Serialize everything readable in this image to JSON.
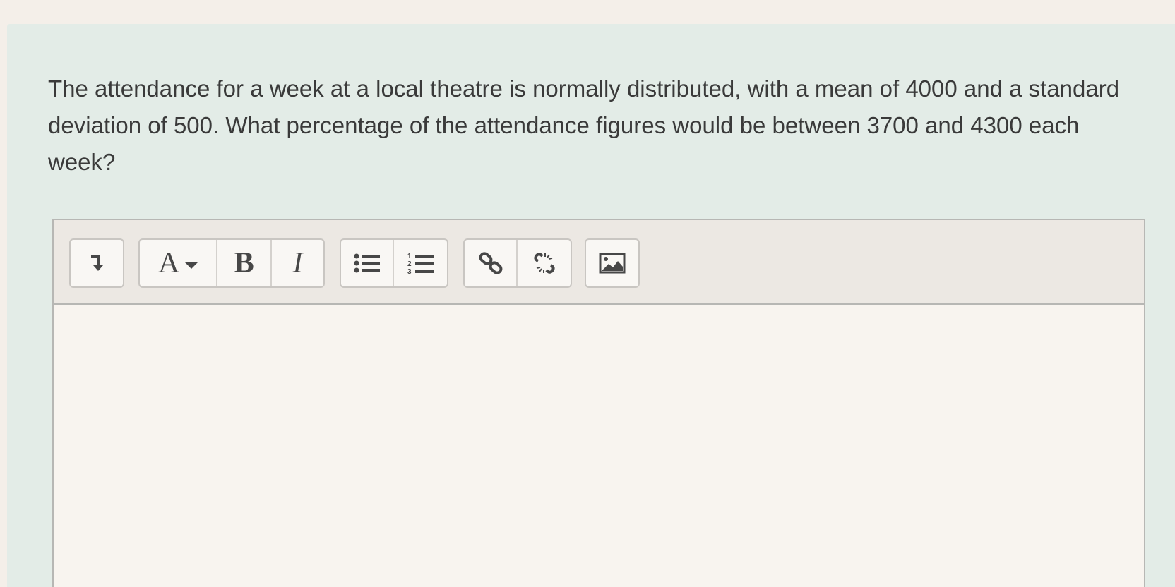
{
  "question": {
    "text": "The attendance for a week at a local theatre is normally distributed, with a mean of 4000 and a standard deviation of 500. What percentage of the attendance figures would be between 3700 and 4300 each week?"
  },
  "toolbar": {
    "groups": [
      {
        "name": "toggle",
        "buttons": [
          {
            "icon": "expand-toolbar-icon"
          }
        ]
      },
      {
        "name": "text-format",
        "buttons": [
          {
            "icon": "font-style-icon",
            "label": "A"
          },
          {
            "icon": "bold-icon",
            "label": "B"
          },
          {
            "icon": "italic-icon",
            "label": "I"
          }
        ]
      },
      {
        "name": "lists",
        "buttons": [
          {
            "icon": "unordered-list-icon"
          },
          {
            "icon": "ordered-list-icon"
          }
        ]
      },
      {
        "name": "links",
        "buttons": [
          {
            "icon": "link-icon"
          },
          {
            "icon": "unlink-icon"
          }
        ]
      },
      {
        "name": "media",
        "buttons": [
          {
            "icon": "image-icon"
          }
        ]
      }
    ]
  },
  "editor": {
    "content": ""
  },
  "colors": {
    "panel_background": "#e3ece7",
    "page_background": "#f4efe9",
    "text": "#3a3a3a",
    "icon": "#474747",
    "border": "#b7b7b4"
  }
}
